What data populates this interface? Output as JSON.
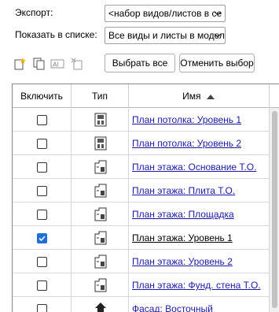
{
  "export_label": "Экспорт:",
  "export_value": "<набор видов/листов в се",
  "show_label": "Показать в списке:",
  "show_value": "Все виды и листы в модел",
  "buttons": {
    "select_all": "Выбрать все",
    "deselect": "Отменить выбор"
  },
  "columns": {
    "include": "Включить",
    "type": "Тип",
    "name": "Имя"
  },
  "rows": [
    {
      "name": "План потолка: Уровень 1",
      "checked": false,
      "icon": "ceiling-plan-icon",
      "link": true
    },
    {
      "name": "План потолка: Уровень 2",
      "checked": false,
      "icon": "ceiling-plan-icon",
      "link": true
    },
    {
      "name": "План этажа: Основание Т.О.",
      "checked": false,
      "icon": "floor-plan-icon",
      "link": true
    },
    {
      "name": "План этажа: Плита Т.О.",
      "checked": false,
      "icon": "floor-plan-icon",
      "link": true
    },
    {
      "name": "План этажа: Площадка",
      "checked": false,
      "icon": "floor-plan-icon",
      "link": true
    },
    {
      "name": "План этажа: Уровень 1",
      "checked": true,
      "icon": "floor-plan-icon",
      "link": false
    },
    {
      "name": "План этажа: Уровень 2",
      "checked": false,
      "icon": "floor-plan-icon",
      "link": true
    },
    {
      "name": "План этажа: Фунд. стена Т.О.",
      "checked": false,
      "icon": "floor-plan-icon",
      "link": true
    },
    {
      "name": "Фасад: Восточный",
      "checked": false,
      "icon": "elevation-icon",
      "link": true
    }
  ]
}
